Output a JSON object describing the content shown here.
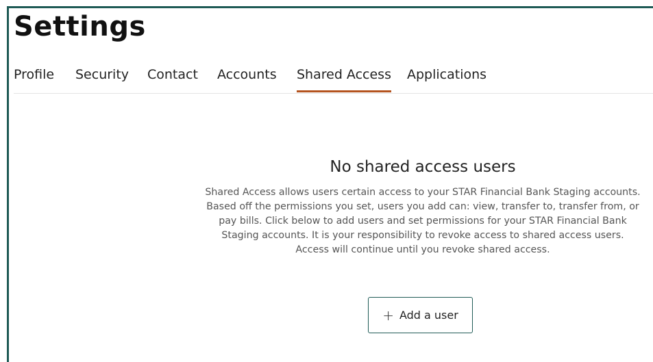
{
  "page": {
    "title": "Settings"
  },
  "tabs": [
    {
      "label": "Profile"
    },
    {
      "label": "Security"
    },
    {
      "label": "Contact"
    },
    {
      "label": "Accounts"
    },
    {
      "label": "Shared Access",
      "active": true
    },
    {
      "label": "Applications"
    }
  ],
  "empty_state": {
    "title": "No shared access users",
    "description": "Shared Access allows users certain access to your STAR Financial Bank Staging accounts. Based off the permissions you set, users you add can: view, transfer to, transfer from, or pay bills. Click below to add users and set permissions for your STAR Financial Bank Staging accounts. It is your responsibility to revoke access to shared access users. Access will continue until you revoke shared access.",
    "add_button_icon": "plus-icon",
    "add_button_label": "Add a user"
  },
  "colors": {
    "accent_border": "#1e5a55",
    "active_tab_underline": "#b4531e"
  }
}
